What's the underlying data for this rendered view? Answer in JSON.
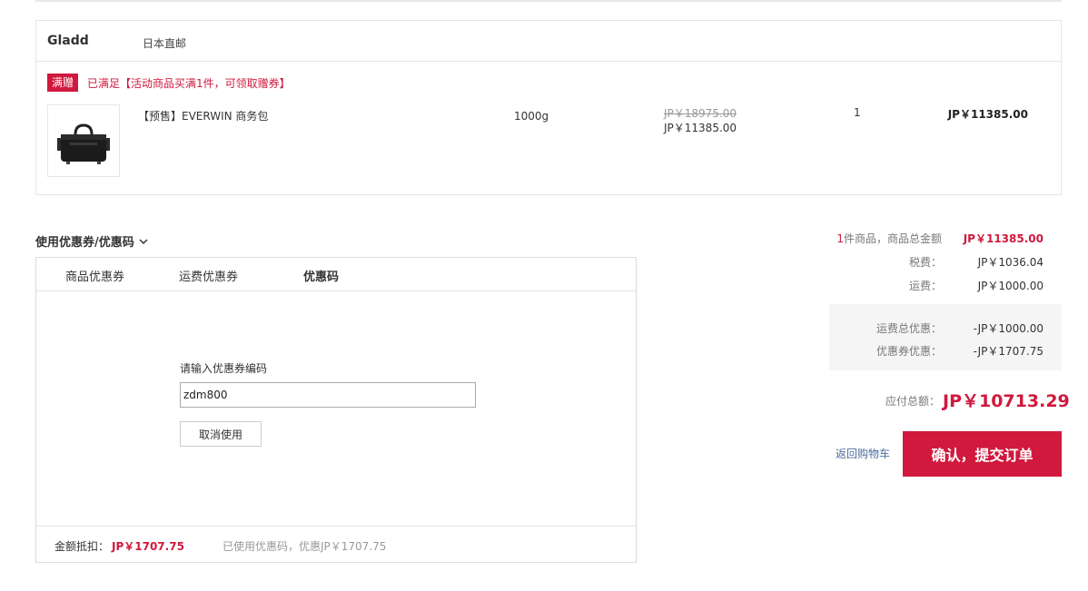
{
  "store": {
    "name": "Gladd",
    "shipping_type": "日本直邮"
  },
  "promo": {
    "tag": "满赠",
    "text": "已满足【活动商品买满1件，可领取赠券】"
  },
  "product": {
    "name": "【预售】EVERWIN 商务包",
    "weight": "1000g",
    "original_price": "JP￥18975.00",
    "price": "JP￥11385.00",
    "quantity": "1",
    "line_total": "JP￥11385.00",
    "image_icon": "briefcase-icon"
  },
  "coupon": {
    "section_title": "使用优惠券/优惠码",
    "tabs": [
      {
        "label": "商品优惠券",
        "active": false
      },
      {
        "label": "运费优惠券",
        "active": false
      },
      {
        "label": "优惠码",
        "active": true
      }
    ],
    "input_label": "请输入优惠券编码",
    "input_value": "zdm800",
    "cancel_label": "取消使用",
    "deduct_label": "金额抵扣：",
    "deduct_amount": "JP￥1707.75",
    "used_note": "已使用优惠码，优惠JP￥1707.75"
  },
  "summary": {
    "count": "1",
    "count_label": "件商品，商品总金额",
    "total": "JP￥11385.00",
    "tax_label": "税费：",
    "tax": "JP￥1036.04",
    "shipping_label": "运费：",
    "shipping": "JP￥1000.00",
    "shipping_discount_label": "运费总优惠：",
    "shipping_discount": "-JP￥1000.00",
    "coupon_discount_label": "优惠券优惠：",
    "coupon_discount": "-JP￥1707.75",
    "payable_label": "应付总额：",
    "payable": "JP￥10713.29"
  },
  "actions": {
    "back_label": "返回购物车",
    "submit_label": "确认，提交订单"
  },
  "colors": {
    "accent": "#d0193d",
    "link": "#4a6d9c"
  }
}
